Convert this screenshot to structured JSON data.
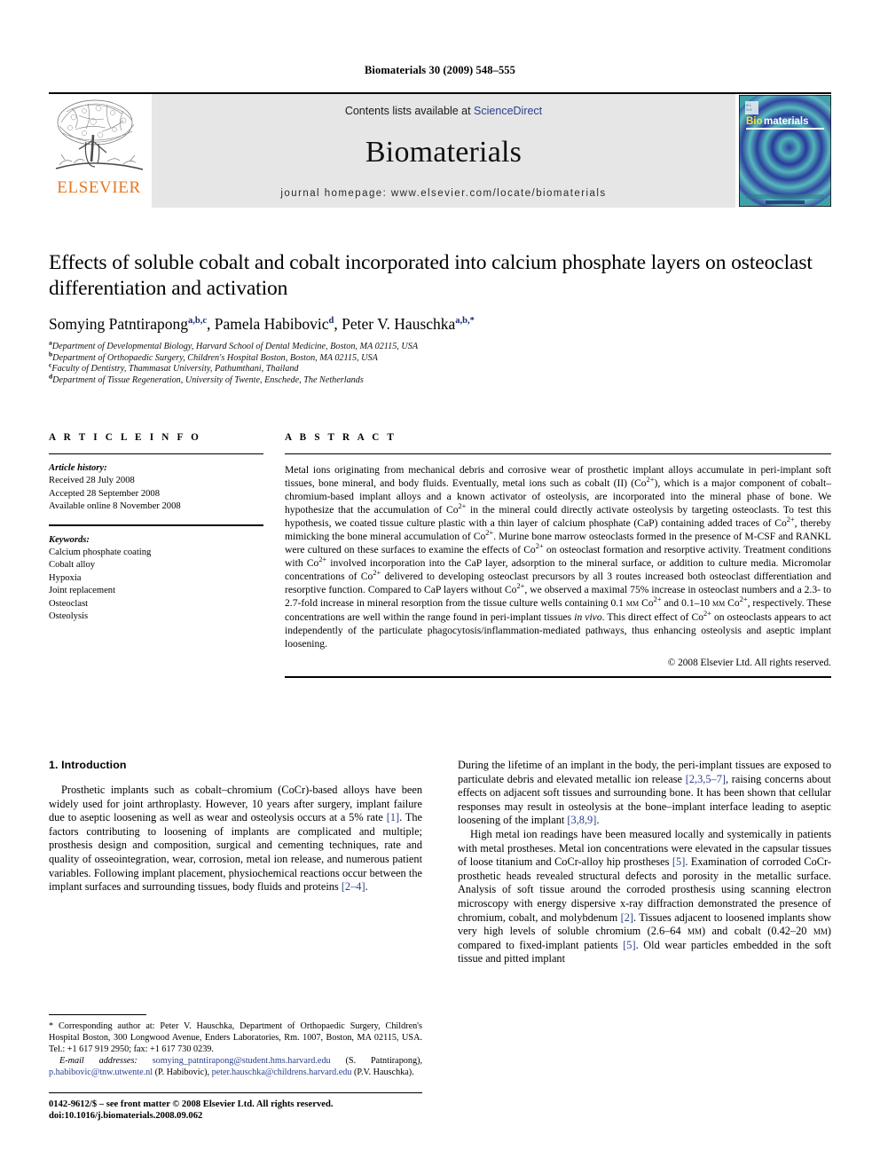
{
  "running_head": "Biomaterials 30 (2009) 548–555",
  "masthead": {
    "publisher_name": "ELSEVIER",
    "contents_prefix": "Contents lists available at ",
    "contents_link": "ScienceDirect",
    "journal_title": "Biomaterials",
    "homepage": "journal homepage: www.elsevier.com/locate/biomaterials",
    "cover_title_bio": "Bio",
    "cover_title_materials": "materials",
    "colors": {
      "elsevier_orange": "#E87722",
      "link_blue": "#2b3e8c",
      "masthead_bg": "#e6e6e6",
      "cover_teal": "#3fa0a8",
      "cover_deep_blue": "#1b3a8f"
    }
  },
  "article": {
    "title": "Effects of soluble cobalt and cobalt incorporated into calcium phosphate layers on osteoclast differentiation and activation",
    "authors": [
      {
        "name": "Somying Patntirapong",
        "sup": "a,b,c",
        "sep": ", "
      },
      {
        "name": "Pamela Habibovic",
        "sup": "d",
        "sep": ", "
      },
      {
        "name": "Peter V. Hauschka",
        "sup": "a,b,*",
        "sep": ""
      }
    ],
    "affiliations": [
      {
        "marker": "a",
        "text": "Department of Developmental Biology, Harvard School of Dental Medicine, Boston, MA 02115, USA"
      },
      {
        "marker": "b",
        "text": "Department of Orthopaedic Surgery, Children's Hospital Boston, Boston, MA 02115, USA"
      },
      {
        "marker": "c",
        "text": "Faculty of Dentistry, Thammasat University, Pathumthani, Thailand"
      },
      {
        "marker": "d",
        "text": "Department of Tissue Regeneration, University of Twente, Enschede, The Netherlands"
      }
    ]
  },
  "article_info": {
    "label": "A R T I C L E    I N F O",
    "history_title": "Article history:",
    "history": [
      "Received 28 July 2008",
      "Accepted 28 September 2008",
      "Available online 8 November 2008"
    ],
    "keywords_title": "Keywords:",
    "keywords": [
      "Calcium phosphate coating",
      "Cobalt alloy",
      "Hypoxia",
      "Joint replacement",
      "Osteoclast",
      "Osteolysis"
    ]
  },
  "abstract": {
    "label": "A B S T R A C T",
    "copyright": "© 2008 Elsevier Ltd. All rights reserved."
  },
  "introduction": {
    "heading": "1. Introduction",
    "left_paragraphs": [
      "Prosthetic implants such as cobalt–chromium (CoCr)-based alloys have been widely used for joint arthroplasty. However, 10 years after surgery, implant failure due to aseptic loosening as well as wear and osteolysis occurs at a 5% rate [1]. The factors contributing to loosening of implants are complicated and multiple; prosthesis design and composition, surgical and cementing techniques, rate and quality of osseointegration, wear, corrosion, metal ion release, and numerous patient variables. Following implant placement, physiochemical reactions occur between the implant surfaces and surrounding tissues, body fluids and proteins [2–4]."
    ],
    "right_paragraphs": [
      "During the lifetime of an implant in the body, the peri-implant tissues are exposed to particulate debris and elevated metallic ion release [2,3,5–7], raising concerns about effects on adjacent soft tissues and surrounding bone. It has been shown that cellular responses may result in osteolysis at the bone–implant interface leading to aseptic loosening of the implant [3,8,9].",
      "High metal ion readings have been measured locally and systemically in patients with metal prostheses. Metal ion concentrations were elevated in the capsular tissues of loose titanium and CoCr-alloy hip prostheses [5]. Examination of corroded CoCr-prosthetic heads revealed structural defects and porosity in the metallic surface. Analysis of soft tissue around the corroded prosthesis using scanning electron microscopy with energy dispersive x-ray diffraction demonstrated the presence of chromium, cobalt, and molybdenum [2]. Tissues adjacent to loosened implants show very high levels of soluble chromium (2.6–64 μм) and cobalt (0.42–20 μм) compared to fixed-implant patients [5]. Old wear particles embedded in the soft tissue and pitted implant"
    ]
  },
  "footnote": {
    "corresponding": "* Corresponding author at: Peter V. Hauschka, Department of Orthopaedic Surgery, Children's Hospital Boston, 300 Longwood Avenue, Enders Laboratories, Rm. 1007, Boston, MA 02115, USA. Tel.: +1 617 919 2950; fax: +1 617 730 0239.",
    "email_label": "E-mail addresses:",
    "emails": [
      {
        "address": "somying_patntirapong@student.hms.harvard.edu",
        "owner": "(S. Patntirapong),"
      },
      {
        "address": "p.habibovic@tnw.utwente.nl",
        "owner": "(P. Habibovic),"
      },
      {
        "address": "peter.hauschka@childrens.harvard.edu",
        "owner": "(P.V. Hauschka)."
      }
    ]
  },
  "page_footer": {
    "line1": "0142-9612/$ – see front matter © 2008 Elsevier Ltd. All rights reserved.",
    "line2": "doi:10.1016/j.biomaterials.2008.09.062"
  }
}
